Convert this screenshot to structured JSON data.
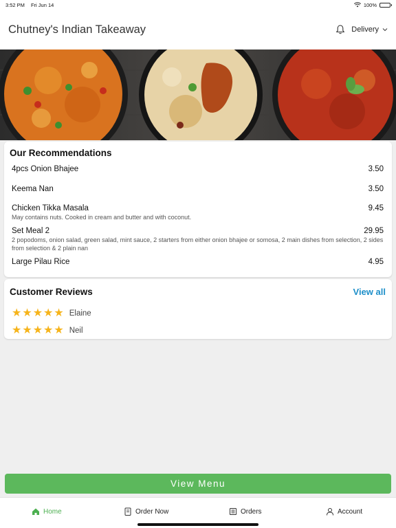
{
  "status_bar": {
    "time": "3:52 PM",
    "date": "Fri Jun 14",
    "battery": "100%"
  },
  "header": {
    "title": "Chutney's Indian Takeaway",
    "delivery_label": "Delivery"
  },
  "recommendations": {
    "title": "Our Recommendations",
    "items": [
      {
        "name": "4pcs Onion Bhajee",
        "price": "3.50",
        "description": ""
      },
      {
        "name": "Keema Nan",
        "price": "3.50",
        "description": ""
      },
      {
        "name": "Chicken Tikka Masala",
        "price": "9.45",
        "description": "May contains nuts. Cooked in cream and butter and with coconut."
      },
      {
        "name": "Set Meal 2",
        "price": "29.95",
        "description": "2 popodoms, onion salad, green salad, mint sauce, 2 starters from either onion bhajee or somosa, 2 main dishes from selection, 2 sides from selection & 2 plain nan"
      },
      {
        "name": "Large Pilau Rice",
        "price": "4.95",
        "description": ""
      }
    ]
  },
  "reviews": {
    "title": "Customer Reviews",
    "view_all_label": "View all",
    "items": [
      {
        "name": "Elaine",
        "rating": 5
      },
      {
        "name": "Neil",
        "rating": 5
      }
    ]
  },
  "view_menu_label": "View Menu",
  "tabs": [
    {
      "label": "Home",
      "icon": "home-icon",
      "active": true
    },
    {
      "label": "Order Now",
      "icon": "order-icon",
      "active": false
    },
    {
      "label": "Orders",
      "icon": "receipt-icon",
      "active": false
    },
    {
      "label": "Account",
      "icon": "account-icon",
      "active": false
    }
  ],
  "colors": {
    "accent_green": "#5cb85c",
    "link_blue": "#1e8fc9",
    "star": "#f6b41b"
  }
}
